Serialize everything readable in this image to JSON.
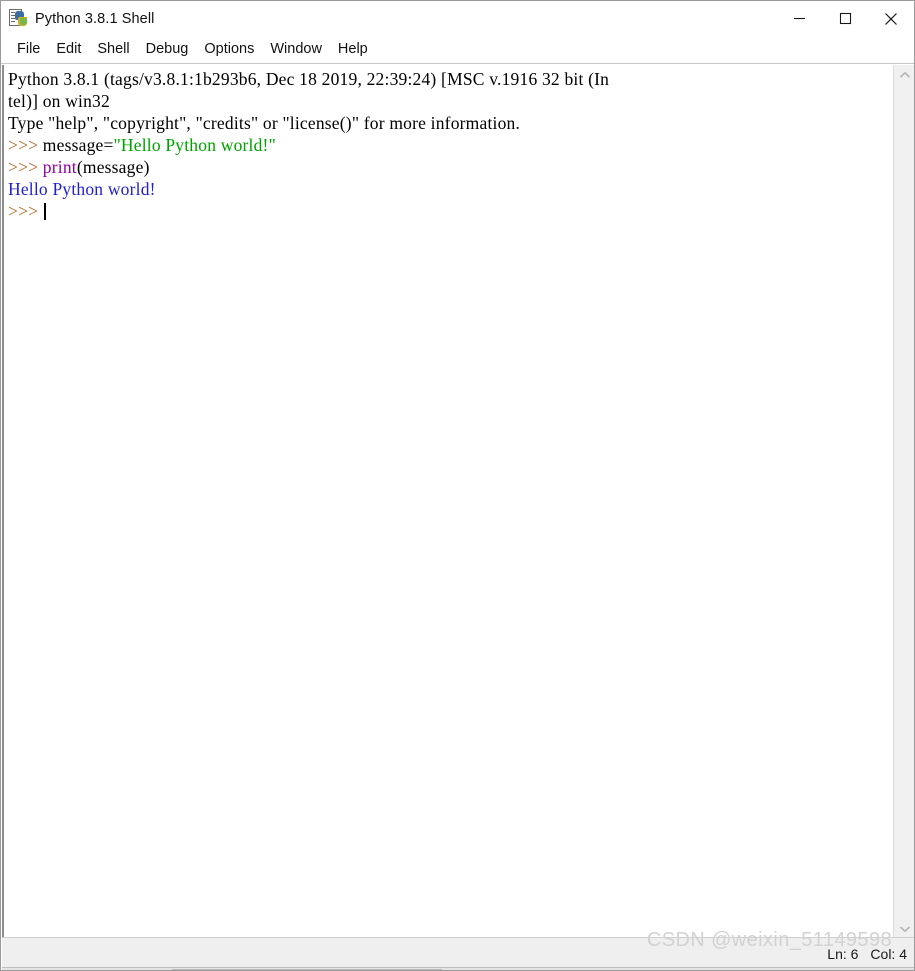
{
  "window": {
    "title": "Python 3.8.1 Shell",
    "icon": "python-idle-icon",
    "controls": {
      "minimize": "minimize-icon",
      "maximize": "maximize-icon",
      "close": "close-icon"
    }
  },
  "menubar": {
    "items": [
      {
        "label": "File"
      },
      {
        "label": "Edit"
      },
      {
        "label": "Shell"
      },
      {
        "label": "Debug"
      },
      {
        "label": "Options"
      },
      {
        "label": "Window"
      },
      {
        "label": "Help"
      }
    ]
  },
  "shell": {
    "lines": [
      {
        "id": "banner-line-1",
        "segments": [
          {
            "text": "Python 3.8.1 (tags/v3.8.1:1b293b6, Dec 18 2019, 22:39:24) [MSC v.1916 32 bit (In",
            "style": "plain"
          }
        ]
      },
      {
        "id": "banner-line-2",
        "segments": [
          {
            "text": "tel)] on win32",
            "style": "plain"
          }
        ]
      },
      {
        "id": "banner-line-3",
        "segments": [
          {
            "text": "Type \"help\", \"copyright\", \"credits\" or \"license()\" for more information.",
            "style": "plain"
          }
        ]
      },
      {
        "id": "input-line-1",
        "segments": [
          {
            "text": ">>> ",
            "style": "prompt"
          },
          {
            "text": "message=",
            "style": "plain"
          },
          {
            "text": "\"Hello Python world!\"",
            "style": "string"
          }
        ]
      },
      {
        "id": "input-line-2",
        "segments": [
          {
            "text": ">>> ",
            "style": "prompt"
          },
          {
            "text": "print",
            "style": "builtin"
          },
          {
            "text": "(message)",
            "style": "plain"
          }
        ]
      },
      {
        "id": "output-line-1",
        "segments": [
          {
            "text": "Hello Python world!",
            "style": "output"
          }
        ]
      },
      {
        "id": "input-line-3",
        "segments": [
          {
            "text": ">>> ",
            "style": "prompt"
          },
          {
            "text": "",
            "style": "caret"
          }
        ]
      }
    ]
  },
  "statusbar": {
    "line_indicator": "Ln: 6",
    "column_indicator": "Col: 4"
  },
  "watermark": {
    "text": "CSDN @weixin_51149598"
  },
  "colors": {
    "prompt": "#b06a28",
    "string": "#00a000",
    "builtin": "#9000a0",
    "output": "#2020d0",
    "plain": "#000000",
    "titlebar_bg": "#ffffff",
    "statusbar_bg": "#efefef",
    "scrollbar_bg": "#f0f0f0"
  }
}
